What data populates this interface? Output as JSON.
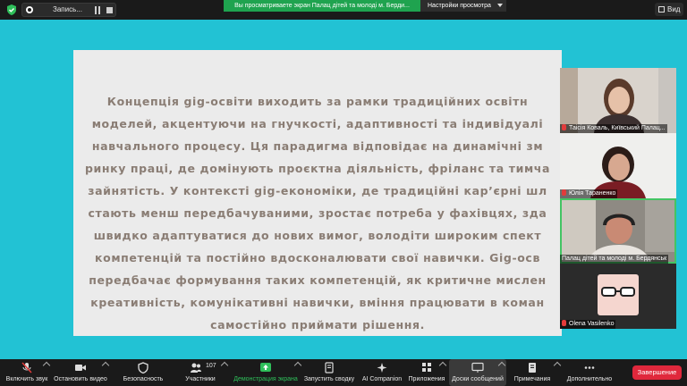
{
  "topbar": {
    "record_label": "Запись...",
    "share_banner": "Вы просматриваете экран Палац дітей та молоді м. Берди...",
    "view_options": "Настройки просмотра",
    "view_button": "Вид"
  },
  "slide": {
    "lines": [
      "Концепція gig-освіти виходить за рамки традиційних освітн",
      "моделей, акцентуючи на гнучкості, адаптивності та індивідуалі",
      "навчального процесу. Ця парадигма відповідає на динамічні зм",
      "ринку праці, де домінують проєктна діяльність, фріланс та тимча",
      "зайнятість. У контексті gig-економіки, де традиційні кар’єрні шл",
      "стають менш передбачуваними, зростає потреба у фахівцях, зда",
      "швидко адаптуватися до нових вимог, володіти широким спект",
      "компетенцій та постійно вдосконалювати свої навички. Gig-осв",
      "передбачає формування таких компетенцій, як критичне мислен",
      "креативність, комунікативні навички, вміння працювати в коман",
      "самостійно приймати рішення."
    ]
  },
  "participants": [
    {
      "name": "Таісія Коваль, Київський Палац..."
    },
    {
      "name": "Юлія Тараненко"
    },
    {
      "name": "Палац дітей та молоді м. Бердянськ"
    },
    {
      "name": "Olena Vasilenko"
    }
  ],
  "toolbar": {
    "audio": "Включить звук",
    "video": "Остановить видео",
    "security": "Безопасность",
    "participants": "Участники",
    "participants_count": "107",
    "share": "Демонстрация экрана",
    "summary": "Запустить сводку",
    "ai": "AI Companion",
    "apps": "Приложения",
    "whiteboards": "Доски сообщений",
    "notes": "Примечания",
    "more": "Дополнительно",
    "end": "Завершение"
  },
  "colors": {
    "background": "#22c2d4",
    "slide_text": "#8a7d74",
    "share_green": "#1fa34f",
    "end_red": "#e0283c"
  }
}
